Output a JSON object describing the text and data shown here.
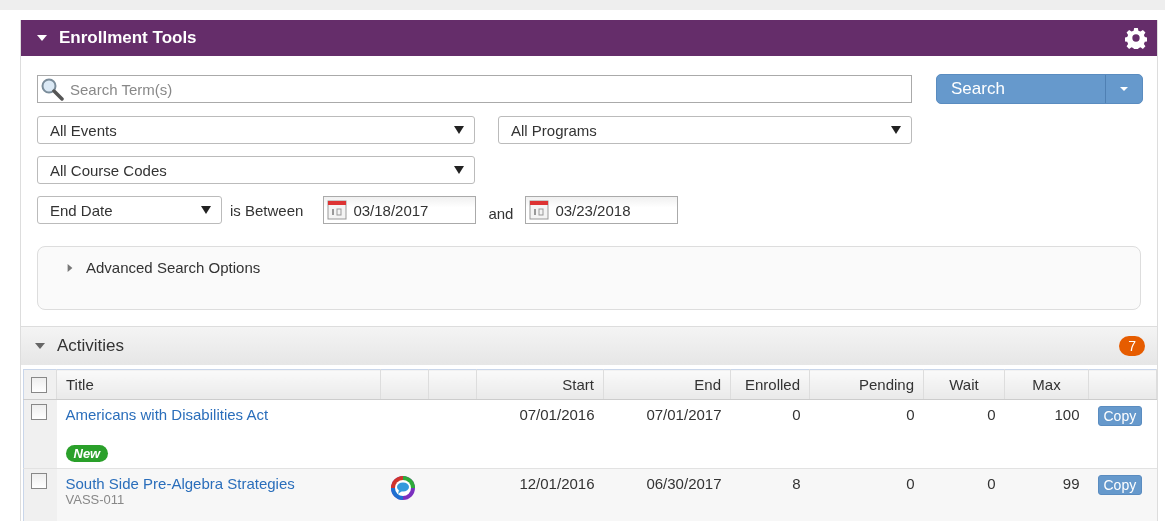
{
  "panel": {
    "title": "Enrollment Tools",
    "expanded": true
  },
  "search": {
    "placeholder": "Search Term(s)",
    "button": "Search"
  },
  "filters": [
    {
      "value": "All Events"
    },
    {
      "value": "All Programs"
    },
    {
      "value": "All Course Codes"
    }
  ],
  "date_filter": {
    "field": "End Date",
    "operator": "is Between",
    "from": "03/18/2017",
    "joiner": "and",
    "to": "03/23/2018"
  },
  "advanced": {
    "label": "Advanced Search Options",
    "expanded": false
  },
  "activities": {
    "title": "Activities",
    "expanded": true,
    "count": "7",
    "columns": [
      {
        "label": "Title"
      },
      {},
      {},
      {
        "label": "Start"
      },
      {
        "label": "End"
      },
      {
        "label": "Enrolled"
      },
      {
        "label": "Pending"
      },
      {
        "label": "Wait"
      },
      {
        "label": "Max"
      }
    ],
    "select_all_checked": false,
    "rows": [
      {
        "kind": "plain",
        "checked": false,
        "title": "Americans with Disabilities Act",
        "badge": "New",
        "start": "07/01/2016",
        "end": "07/01/2017",
        "enrolled": "0",
        "pending": "0",
        "wait": "0",
        "max": "100",
        "action": "Copy"
      },
      {
        "kind": "chat",
        "checked": false,
        "title": "South Side Pre-Algebra Strategies",
        "code": "VASS-011",
        "start": "12/01/2016",
        "end": "06/30/2017",
        "enrolled": "8",
        "pending": "0",
        "wait": "0",
        "max": "99",
        "action": "Copy"
      }
    ]
  }
}
